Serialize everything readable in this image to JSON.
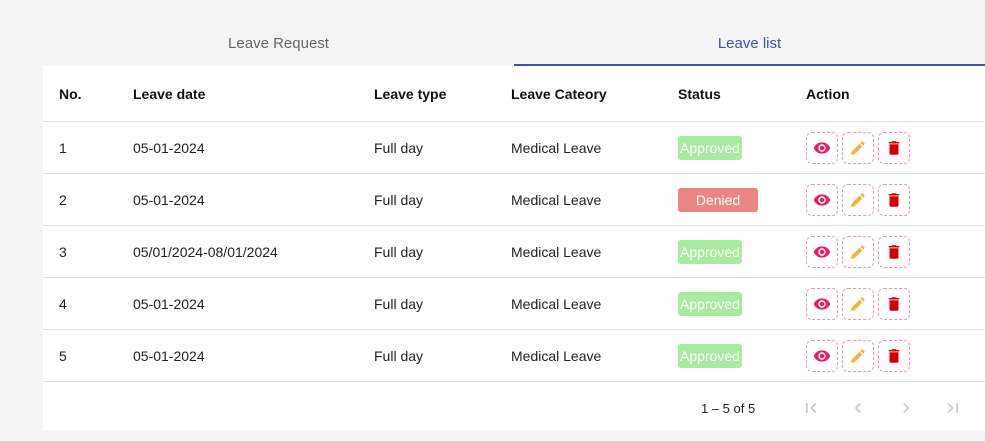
{
  "tabs": [
    {
      "label": "Leave Request",
      "active": false
    },
    {
      "label": "Leave list",
      "active": true
    }
  ],
  "table": {
    "headers": [
      "No.",
      "Leave date",
      "Leave type",
      "Leave Cateory",
      "Status",
      "Action"
    ],
    "rows": [
      {
        "no": "1",
        "date": "05-01-2024",
        "type": "Full day",
        "category": "Medical Leave",
        "status": "Approved"
      },
      {
        "no": "2",
        "date": "05-01-2024",
        "type": "Full day",
        "category": "Medical Leave",
        "status": "Denied"
      },
      {
        "no": "3",
        "date": "05/01/2024-08/01/2024",
        "type": "Full day",
        "category": "Medical Leave",
        "status": "Approved"
      },
      {
        "no": "4",
        "date": "05-01-2024",
        "type": "Full day",
        "category": "Medical Leave",
        "status": "Approved"
      },
      {
        "no": "5",
        "date": "05-01-2024",
        "type": "Full day",
        "category": "Medical Leave",
        "status": "Approved"
      }
    ]
  },
  "actions": {
    "view_icon": "eye-icon",
    "edit_icon": "pencil-icon",
    "delete_icon": "trash-icon"
  },
  "pagination": {
    "range": "1 – 5 of 5",
    "buttons": [
      "first-page-icon",
      "previous-page-icon",
      "next-page-icon",
      "last-page-icon"
    ]
  },
  "colors": {
    "accent": "#3f51b5",
    "approved": "#a8eba0",
    "denied": "#ec8686",
    "view": "#e91e63",
    "edit": "#f5b342",
    "delete": "#d50000"
  }
}
